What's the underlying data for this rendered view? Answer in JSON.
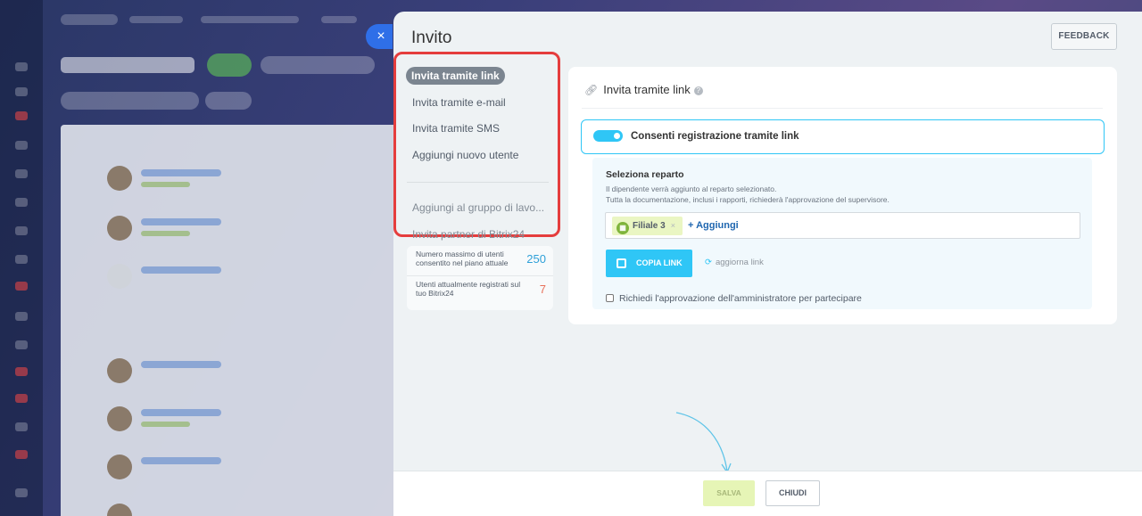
{
  "background": {
    "accent_color": "#2f6fe8"
  },
  "slider": {
    "title": "Invito",
    "close_glyph": "×",
    "feedback_label": "FEEDBACK"
  },
  "menu": {
    "items": [
      {
        "label": "Invita tramite link",
        "active": true
      },
      {
        "label": "Invita tramite e-mail"
      },
      {
        "label": "Invita tramite SMS"
      },
      {
        "label": "Aggiungi nuovo utente"
      }
    ],
    "secondary_items": [
      {
        "label": "Aggiungi al gruppo di lavo..."
      },
      {
        "label": "Invita partner di Bitrix24"
      }
    ],
    "highlight_color": "#e53d3d"
  },
  "limits": {
    "max_users_label": "Numero massimo di utenti consentito nel piano attuale",
    "max_users_value": "250",
    "max_users_color": "#2fa0d8",
    "current_users_label": "Utenti attualmente registrati sul tuo Bitrix24",
    "current_users_value": "7",
    "current_users_color": "#e8705a"
  },
  "card": {
    "heading": "Invita tramite link",
    "toggle_label": "Consenti registrazione tramite link",
    "toggle_on": true,
    "department": {
      "title": "Seleziona reparto",
      "hint_line1": "Il dipendente verrà aggiunto al reparto selezionato.",
      "hint_line2": "Tutta la documentazione, inclusi i rapporti, richiederà l'approvazione del supervisore.",
      "tag_label": "Filiale 3",
      "tag_remove": "×",
      "add_label": "+ Aggiungi"
    },
    "copy_link_label": "COPIA LINK",
    "refresh_label": "aggiorna link",
    "refresh_glyph": "⟳",
    "approval_label": "Richiedi l'approvazione dell'amministratore per partecipare",
    "approval_checked": false,
    "accent_color": "#2fc6f6"
  },
  "footer": {
    "save_label": "SALVA",
    "close_label": "CHIUDI"
  }
}
